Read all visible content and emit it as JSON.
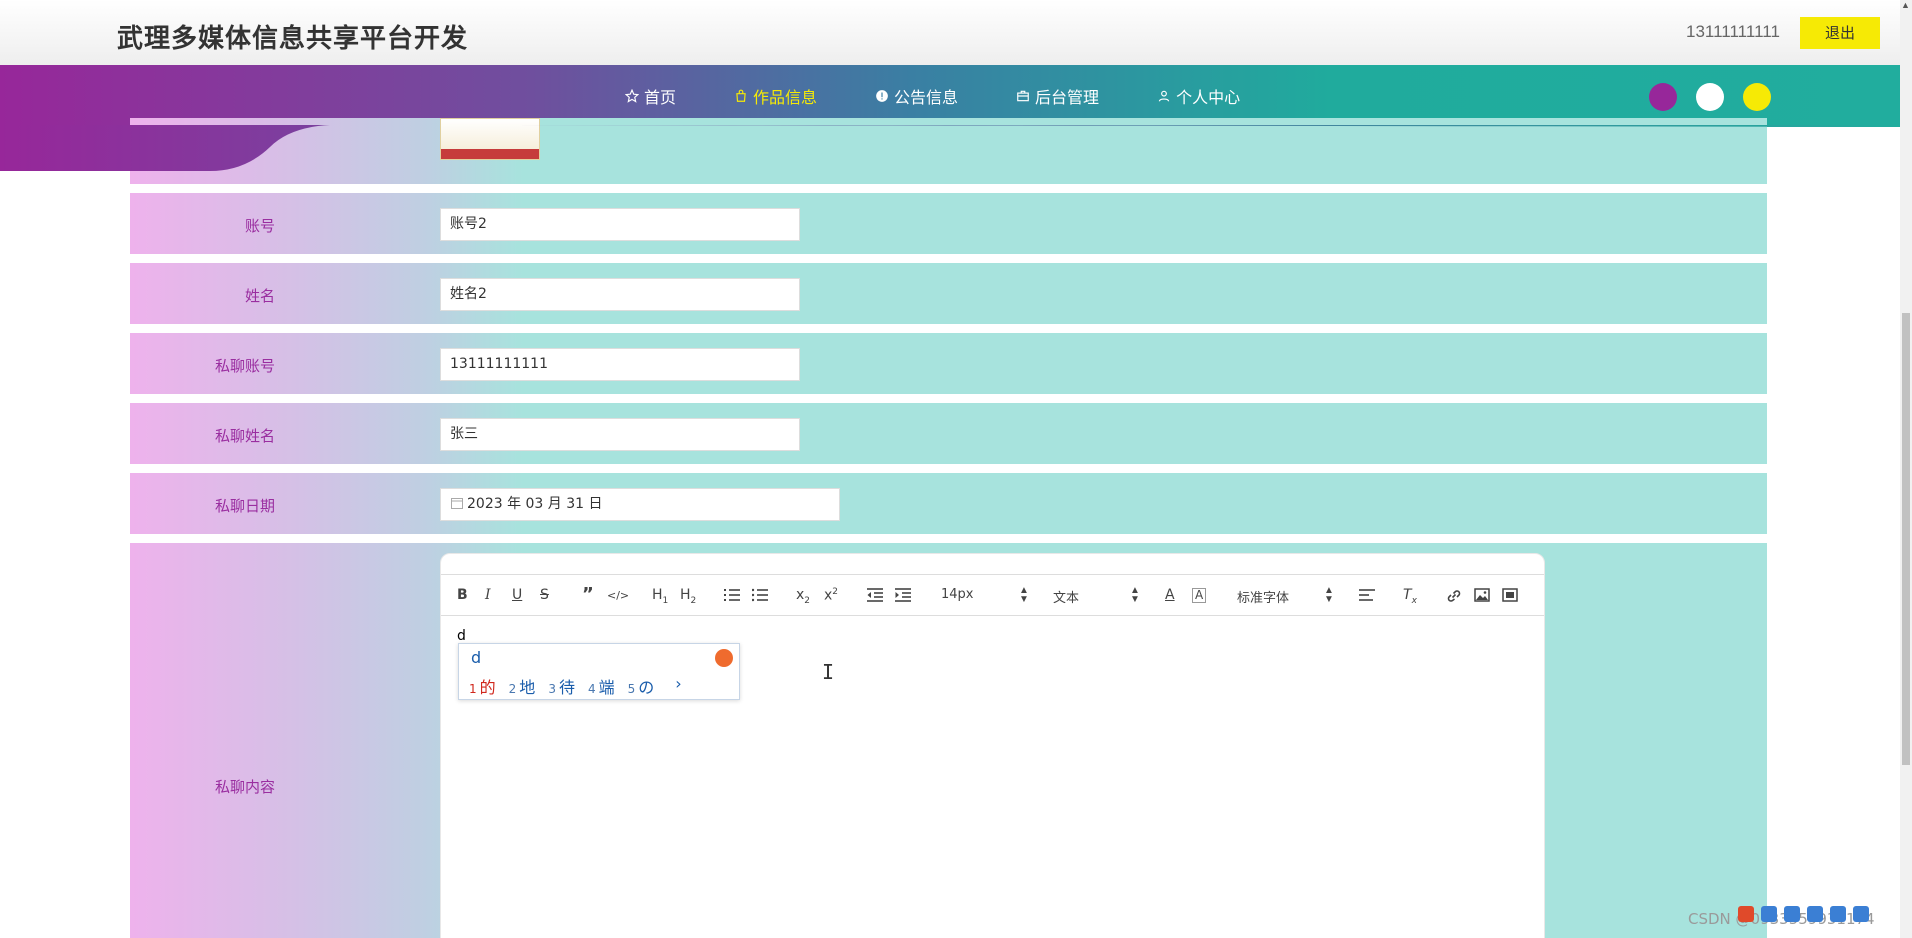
{
  "header": {
    "site_title": "武理多媒体信息共享平台开发",
    "user": "13111111111",
    "logout_label": "退出"
  },
  "nav": {
    "items": [
      {
        "label": "首页",
        "icon": "star-icon",
        "active": false
      },
      {
        "label": "作品信息",
        "icon": "bag-icon",
        "active": true
      },
      {
        "label": "公告信息",
        "icon": "info-icon",
        "active": false
      },
      {
        "label": "后台管理",
        "icon": "briefcase-icon",
        "active": false
      },
      {
        "label": "个人中心",
        "icon": "user-icon",
        "active": false
      }
    ],
    "theme_colors": [
      "#97279a",
      "#ffffff",
      "#f6ea05"
    ]
  },
  "form": {
    "fields": [
      {
        "label": "账号",
        "value": "账号2"
      },
      {
        "label": "姓名",
        "value": "姓名2"
      },
      {
        "label": "私聊账号",
        "value": "13111111111"
      },
      {
        "label": "私聊姓名",
        "value": "张三"
      },
      {
        "label": "私聊日期",
        "value": "2023 年 03 月 31 日"
      }
    ],
    "content_label": "私聊内容"
  },
  "editor": {
    "font_size": "14px",
    "heading_select": "文本",
    "font_family": "标准字体",
    "content": "d"
  },
  "ime": {
    "input": "d",
    "candidates": [
      {
        "n": "1",
        "text": "的"
      },
      {
        "n": "2",
        "text": "地"
      },
      {
        "n": "3",
        "text": "待"
      },
      {
        "n": "4",
        "text": "端"
      },
      {
        "n": "5",
        "text": "の"
      }
    ],
    "next": "›"
  },
  "watermark": "CSDN @0933559931174"
}
